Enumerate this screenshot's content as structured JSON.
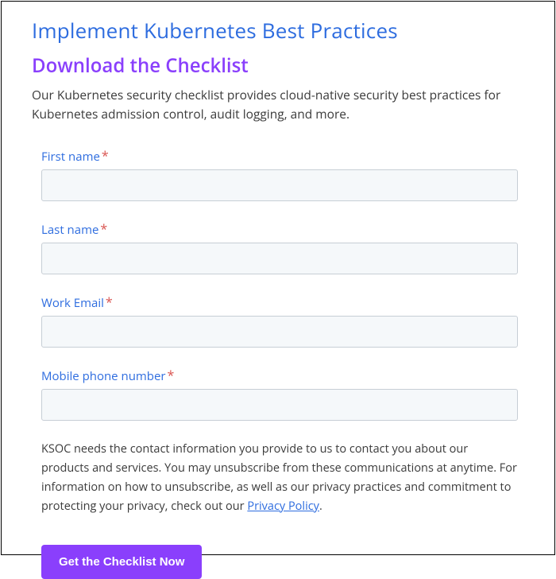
{
  "title": "Implement Kubernetes Best Practices",
  "subtitle": "Download the Checklist",
  "intro": "Our Kubernetes security checklist provides cloud-native security best practices for Kubernetes admission control, audit logging, and more.",
  "fields": {
    "first_name": {
      "label": "First name",
      "required": "*"
    },
    "last_name": {
      "label": "Last name",
      "required": "*"
    },
    "work_email": {
      "label": "Work Email",
      "required": "*"
    },
    "mobile": {
      "label": "Mobile phone number",
      "required": "*"
    }
  },
  "disclaimer": {
    "before": "KSOC needs the contact information you provide to us to contact you about our products and services. You may unsubscribe from these communications at anytime. For information on how to unsubscribe, as well as our privacy practices and commitment to protecting your privacy, check out our ",
    "link": "Privacy Policy",
    "after": "."
  },
  "submit_label": "Get the Checklist Now"
}
